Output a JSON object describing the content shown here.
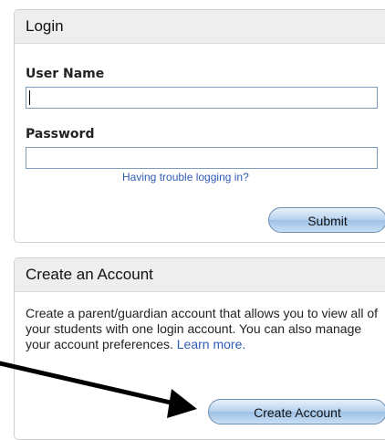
{
  "login": {
    "title": "Login",
    "username_label": "User Name",
    "username_value": "",
    "password_label": "Password",
    "password_value": "",
    "trouble_link": "Having trouble logging in?",
    "submit_label": "Submit"
  },
  "account": {
    "title": "Create an Account",
    "description": "Create a parent/guardian account that allows you to view all of your students with one login account. You can also manage your account preferences.",
    "learn_more": "Learn more.",
    "create_label": "Create Account"
  },
  "colors": {
    "header_bg": "#eeeeee",
    "link": "#2f5cb3",
    "button_border": "#6b8fb2",
    "input_border": "#7f9db9"
  }
}
